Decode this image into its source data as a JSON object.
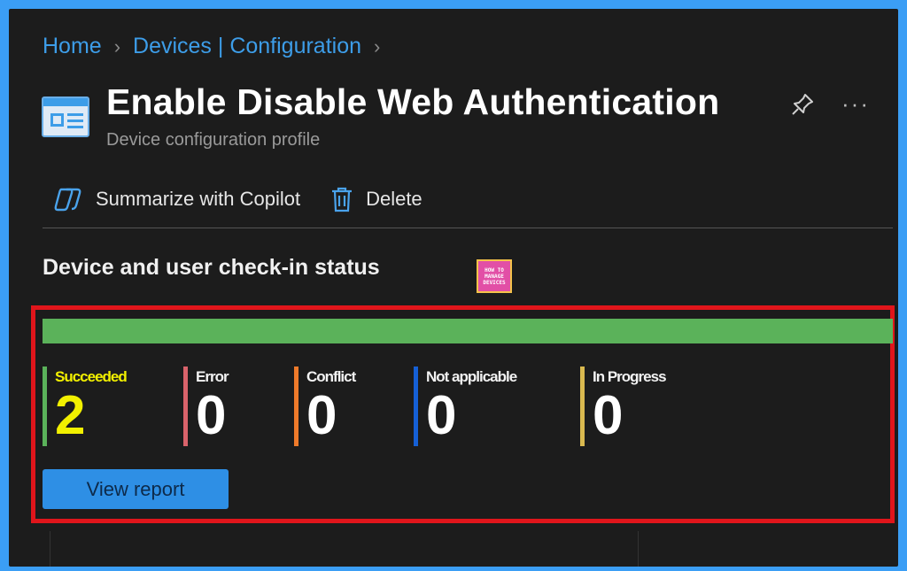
{
  "breadcrumb": {
    "home": "Home",
    "devices": "Devices | Configuration"
  },
  "page": {
    "title": "Enable Disable Web Authentication",
    "subtitle": "Device configuration profile"
  },
  "toolbar": {
    "copilot_label": "Summarize with Copilot",
    "delete_label": "Delete"
  },
  "section": {
    "title": "Device and user check-in status"
  },
  "logo": {
    "line1": "HOW TO",
    "line2": "MANAGE",
    "line3": "DEVICES"
  },
  "progress": {
    "succeeded_fraction": 1.0,
    "color": "#5bb25a"
  },
  "stats": [
    {
      "label": "Succeeded",
      "value": "2",
      "color": "#5bb25a"
    },
    {
      "label": "Error",
      "value": "0",
      "color": "#d9636b"
    },
    {
      "label": "Conflict",
      "value": "0",
      "color": "#ef7a2a"
    },
    {
      "label": "Not applicable",
      "value": "0",
      "color": "#1560d6"
    },
    {
      "label": "In Progress",
      "value": "0",
      "color": "#d9b94f"
    }
  ],
  "actions": {
    "view_report": "View report"
  },
  "colors": {
    "accent": "#3d9de8",
    "highlight": "#e0151b",
    "background": "#1c1c1c"
  }
}
